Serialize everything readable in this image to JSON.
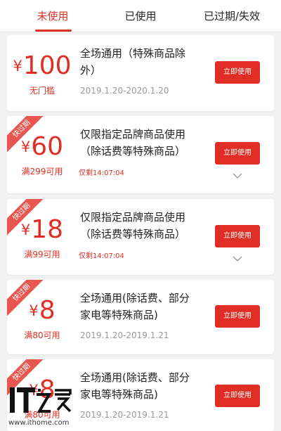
{
  "colors": {
    "accent": "#e02e24",
    "ribbon": "#e8574f",
    "background": "#f2f2f2",
    "card": "#ffffff",
    "date_text": "#9a9a9a"
  },
  "tabs": [
    {
      "label": "未使用",
      "active": true
    },
    {
      "label": "已使用",
      "active": false
    },
    {
      "label": "已过期/失效",
      "active": false
    }
  ],
  "coupons": [
    {
      "currency": "¥",
      "amount": "100",
      "condition": "无门槛",
      "description": "全场通用（特殊商品除外）",
      "date": "2019.1.20-2020.1.20",
      "button_label": "立即使用"
    },
    {
      "ribbon": "快过期",
      "currency": "¥",
      "amount": "60",
      "condition": "满299可用",
      "description": "仅限指定品牌商品使用（除话费等特殊商品）",
      "remaining": "仅剩14:07:04",
      "button_label": "立即使用",
      "chevron_icon": "chevron-down-icon"
    },
    {
      "ribbon": "快过期",
      "currency": "¥",
      "amount": "18",
      "condition": "满99可用",
      "description": "仅限指定品牌商品使用（除话费等特殊商品）",
      "remaining": "仅剩14:07:04",
      "button_label": "立即使用",
      "chevron_icon": "chevron-down-icon"
    },
    {
      "ribbon": "快过期",
      "currency": "¥",
      "amount": "8",
      "condition": "满80可用",
      "description": "全场通用(除话费、部分家电等特殊商品)",
      "date": "2019.1.20-2019.1.21",
      "button_label": "立即使用"
    },
    {
      "ribbon": "快过期",
      "currency": "¥",
      "amount": "8",
      "condition": "满80可用",
      "description": "全场通用(除话费、部分家电等特殊商品)",
      "date": "2019.1.20-2019.1.21",
      "button_label": "立即使用"
    }
  ],
  "watermark": {
    "logo_text": "IT之家",
    "url": "www.ithome.com"
  }
}
